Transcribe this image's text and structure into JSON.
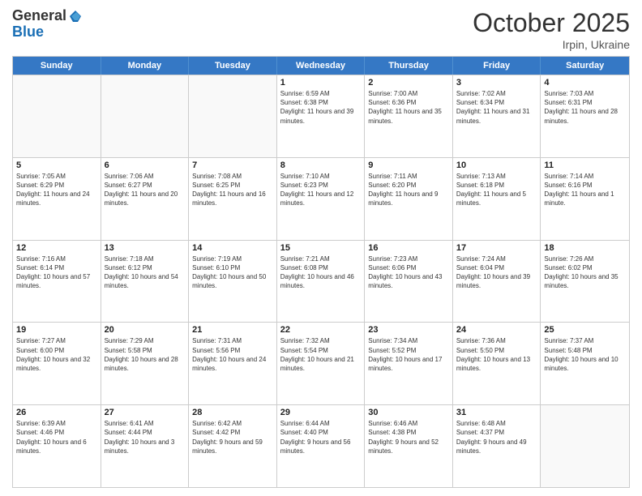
{
  "header": {
    "logo_general": "General",
    "logo_blue": "Blue",
    "month_title": "October 2025",
    "subtitle": "Irpin, Ukraine"
  },
  "calendar": {
    "days_of_week": [
      "Sunday",
      "Monday",
      "Tuesday",
      "Wednesday",
      "Thursday",
      "Friday",
      "Saturday"
    ],
    "rows": [
      [
        {
          "day": "",
          "empty": true
        },
        {
          "day": "",
          "empty": true
        },
        {
          "day": "",
          "empty": true
        },
        {
          "day": "1",
          "sunrise": "6:59 AM",
          "sunset": "6:38 PM",
          "daylight": "11 hours and 39 minutes."
        },
        {
          "day": "2",
          "sunrise": "7:00 AM",
          "sunset": "6:36 PM",
          "daylight": "11 hours and 35 minutes."
        },
        {
          "day": "3",
          "sunrise": "7:02 AM",
          "sunset": "6:34 PM",
          "daylight": "11 hours and 31 minutes."
        },
        {
          "day": "4",
          "sunrise": "7:03 AM",
          "sunset": "6:31 PM",
          "daylight": "11 hours and 28 minutes."
        }
      ],
      [
        {
          "day": "5",
          "sunrise": "7:05 AM",
          "sunset": "6:29 PM",
          "daylight": "11 hours and 24 minutes."
        },
        {
          "day": "6",
          "sunrise": "7:06 AM",
          "sunset": "6:27 PM",
          "daylight": "11 hours and 20 minutes."
        },
        {
          "day": "7",
          "sunrise": "7:08 AM",
          "sunset": "6:25 PM",
          "daylight": "11 hours and 16 minutes."
        },
        {
          "day": "8",
          "sunrise": "7:10 AM",
          "sunset": "6:23 PM",
          "daylight": "11 hours and 12 minutes."
        },
        {
          "day": "9",
          "sunrise": "7:11 AM",
          "sunset": "6:20 PM",
          "daylight": "11 hours and 9 minutes."
        },
        {
          "day": "10",
          "sunrise": "7:13 AM",
          "sunset": "6:18 PM",
          "daylight": "11 hours and 5 minutes."
        },
        {
          "day": "11",
          "sunrise": "7:14 AM",
          "sunset": "6:16 PM",
          "daylight": "11 hours and 1 minute."
        }
      ],
      [
        {
          "day": "12",
          "sunrise": "7:16 AM",
          "sunset": "6:14 PM",
          "daylight": "10 hours and 57 minutes."
        },
        {
          "day": "13",
          "sunrise": "7:18 AM",
          "sunset": "6:12 PM",
          "daylight": "10 hours and 54 minutes."
        },
        {
          "day": "14",
          "sunrise": "7:19 AM",
          "sunset": "6:10 PM",
          "daylight": "10 hours and 50 minutes."
        },
        {
          "day": "15",
          "sunrise": "7:21 AM",
          "sunset": "6:08 PM",
          "daylight": "10 hours and 46 minutes."
        },
        {
          "day": "16",
          "sunrise": "7:23 AM",
          "sunset": "6:06 PM",
          "daylight": "10 hours and 43 minutes."
        },
        {
          "day": "17",
          "sunrise": "7:24 AM",
          "sunset": "6:04 PM",
          "daylight": "10 hours and 39 minutes."
        },
        {
          "day": "18",
          "sunrise": "7:26 AM",
          "sunset": "6:02 PM",
          "daylight": "10 hours and 35 minutes."
        }
      ],
      [
        {
          "day": "19",
          "sunrise": "7:27 AM",
          "sunset": "6:00 PM",
          "daylight": "10 hours and 32 minutes."
        },
        {
          "day": "20",
          "sunrise": "7:29 AM",
          "sunset": "5:58 PM",
          "daylight": "10 hours and 28 minutes."
        },
        {
          "day": "21",
          "sunrise": "7:31 AM",
          "sunset": "5:56 PM",
          "daylight": "10 hours and 24 minutes."
        },
        {
          "day": "22",
          "sunrise": "7:32 AM",
          "sunset": "5:54 PM",
          "daylight": "10 hours and 21 minutes."
        },
        {
          "day": "23",
          "sunrise": "7:34 AM",
          "sunset": "5:52 PM",
          "daylight": "10 hours and 17 minutes."
        },
        {
          "day": "24",
          "sunrise": "7:36 AM",
          "sunset": "5:50 PM",
          "daylight": "10 hours and 13 minutes."
        },
        {
          "day": "25",
          "sunrise": "7:37 AM",
          "sunset": "5:48 PM",
          "daylight": "10 hours and 10 minutes."
        }
      ],
      [
        {
          "day": "26",
          "sunrise": "6:39 AM",
          "sunset": "4:46 PM",
          "daylight": "10 hours and 6 minutes."
        },
        {
          "day": "27",
          "sunrise": "6:41 AM",
          "sunset": "4:44 PM",
          "daylight": "10 hours and 3 minutes."
        },
        {
          "day": "28",
          "sunrise": "6:42 AM",
          "sunset": "4:42 PM",
          "daylight": "9 hours and 59 minutes."
        },
        {
          "day": "29",
          "sunrise": "6:44 AM",
          "sunset": "4:40 PM",
          "daylight": "9 hours and 56 minutes."
        },
        {
          "day": "30",
          "sunrise": "6:46 AM",
          "sunset": "4:38 PM",
          "daylight": "9 hours and 52 minutes."
        },
        {
          "day": "31",
          "sunrise": "6:48 AM",
          "sunset": "4:37 PM",
          "daylight": "9 hours and 49 minutes."
        },
        {
          "day": "",
          "empty": true
        }
      ]
    ]
  }
}
